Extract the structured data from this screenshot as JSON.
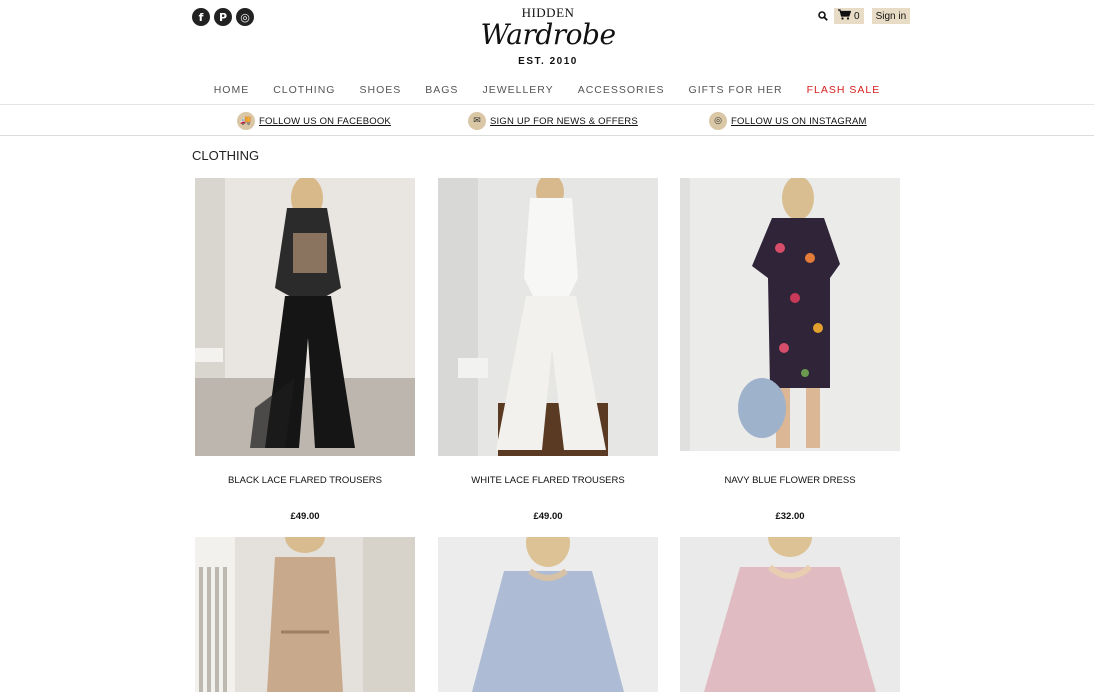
{
  "header": {
    "logo": {
      "top": "HIDDEN",
      "main": "Wardrobe",
      "est": "EST. 2010"
    },
    "social": [
      {
        "icon": "facebook-icon",
        "glyph": "f"
      },
      {
        "icon": "pinterest-icon",
        "glyph": "P"
      },
      {
        "icon": "instagram-icon",
        "glyph": "◎"
      }
    ],
    "cart_count": "0",
    "signin_label": "Sign in"
  },
  "nav": {
    "items": [
      "HOME",
      "CLOTHING",
      "SHOES",
      "BAGS",
      "JEWELLERY",
      "ACCESSORIES",
      "GIFTS FOR HER",
      "FLASH SALE"
    ]
  },
  "promo_bar": {
    "links": [
      {
        "label": "FOLLOW US ON FACEBOOK",
        "icon": "truck-icon"
      },
      {
        "label": "SIGN UP FOR NEWS & OFFERS",
        "icon": "mail-icon"
      },
      {
        "label": "FOLLOW US ON INSTAGRAM",
        "icon": "instagram-icon"
      }
    ]
  },
  "page": {
    "title": "CLOTHING"
  },
  "products": [
    {
      "name": "BLACK LACE FLARED TROUSERS",
      "price": "£49.00"
    },
    {
      "name": "WHITE LACE FLARED TROUSERS",
      "price": "£49.00"
    },
    {
      "name": "NAVY BLUE FLOWER DRESS",
      "price": "£32.00"
    },
    {
      "name": "",
      "price": ""
    },
    {
      "name": "",
      "price": ""
    },
    {
      "name": "",
      "price": ""
    }
  ],
  "colors": {
    "accent": "#e8dcc6",
    "sale": "#d62020",
    "badge": "#d9c7a6"
  }
}
